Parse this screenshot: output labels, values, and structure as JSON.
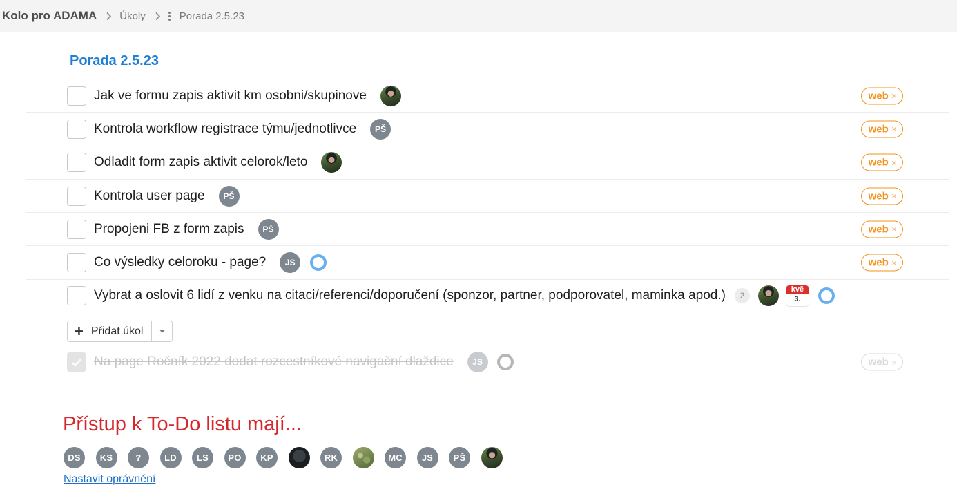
{
  "breadcrumb": {
    "project": "Kolo pro ADAMA",
    "section": "Úkoly",
    "current": "Porada 2.5.23"
  },
  "list": {
    "title": "Porada 2.5.23",
    "tasks": [
      {
        "text": "Jak ve formu zapis aktivit km osobni/skupinove",
        "assignee": "photo",
        "tag": "web",
        "tag_remove": "×"
      },
      {
        "text": "Kontrola workflow registrace týmu/jednotlivce",
        "assignee": "PŠ",
        "tag": "web",
        "tag_remove": "×"
      },
      {
        "text": "Odladit form zapis aktivit celorok/leto",
        "assignee": "photo",
        "tag": "web",
        "tag_remove": "×"
      },
      {
        "text": "Kontrola user page",
        "assignee": "PŠ",
        "tag": "web",
        "tag_remove": "×"
      },
      {
        "text": "Propojeni FB z form zapis",
        "assignee": "PŠ",
        "tag": "web",
        "tag_remove": "×"
      },
      {
        "text": "Co výsledky celoroku - page?",
        "assignee": "JS",
        "progress_icon": "progress-ring",
        "tag": "web",
        "tag_remove": "×"
      },
      {
        "text": "Vybrat a oslovit 6 lidí z venku na citaci/referenci/doporučení (sponzor, partner, podporovatel, maminka apod.)",
        "comments": "2",
        "assignee": "photo",
        "due_month": "kvě",
        "due_day": "3.",
        "progress_icon": "progress-ring"
      }
    ],
    "add_task_label": "Přidat úkol",
    "completed": {
      "text": "Na page Ročník 2022 dodat rozcestníkové navigační dlaždice",
      "assignee": "JS",
      "tag": "web",
      "tag_remove": "×"
    }
  },
  "access": {
    "title": "Přístup k To-Do listu mají...",
    "members": [
      "DS",
      "KS",
      "?",
      "LD",
      "LS",
      "PO",
      "KP",
      "photo-dark",
      "RK",
      "photo-green",
      "MC",
      "JS",
      "PŠ",
      "photo"
    ],
    "permissions_link": "Nastavit oprávnění"
  },
  "colors": {
    "title_blue": "#1f7fd6",
    "tag_orange": "#f0941e",
    "access_red": "#d4282c",
    "link_blue": "#1f6fc8",
    "avatar_gray": "#7e8790"
  }
}
